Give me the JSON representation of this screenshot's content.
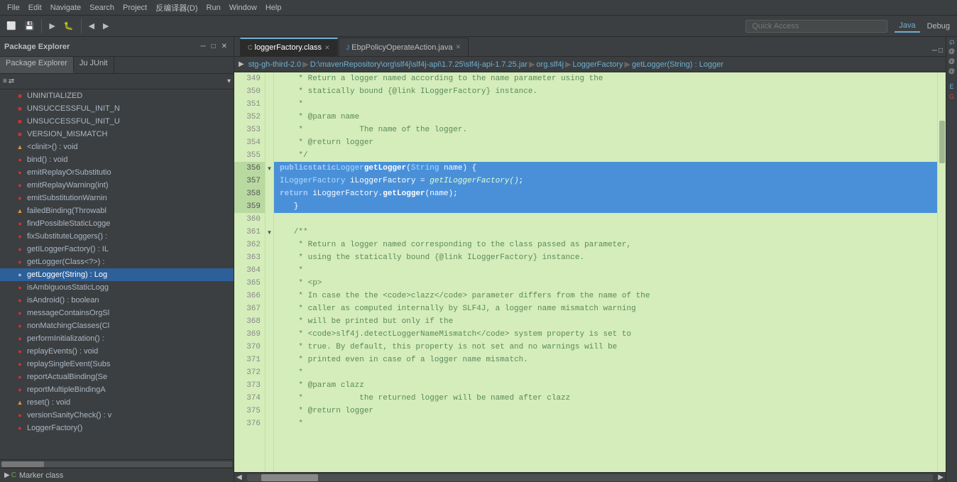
{
  "menubar": {
    "items": [
      "File",
      "Edit",
      "Navigate",
      "Search",
      "Project",
      "反编译器(D)",
      "Run",
      "Window",
      "Help"
    ]
  },
  "toolbar": {
    "quick_access_placeholder": "Quick Access",
    "right_buttons": [
      "Java",
      "Debug"
    ]
  },
  "left_panel": {
    "title": "Package Explorer",
    "tabs": [
      {
        "label": "Package Explorer",
        "active": true
      },
      {
        "label": "Ju JUnit",
        "active": false
      }
    ],
    "tree_items": [
      {
        "label": "UNINITIALIZED",
        "type": "field",
        "indent": 4
      },
      {
        "label": "UNSUCCESSFUL_INIT_N",
        "type": "field",
        "indent": 4
      },
      {
        "label": "UNSUCCESSFUL_INIT_U",
        "type": "field",
        "indent": 4
      },
      {
        "label": "VERSION_MISMATCH",
        "type": "field",
        "indent": 4
      },
      {
        "label": "<clinit>() : void",
        "type": "method-warn",
        "indent": 4
      },
      {
        "label": "bind() : void",
        "type": "method-green",
        "indent": 4
      },
      {
        "label": "emitReplayOrSubstitutio",
        "type": "method-green",
        "indent": 4
      },
      {
        "label": "emitReplayWarning(int)",
        "type": "method-green",
        "indent": 4
      },
      {
        "label": "emitSubstitutionWarnin",
        "type": "method-green",
        "indent": 4
      },
      {
        "label": "failedBinding(Throwabl",
        "type": "method-warn",
        "indent": 4
      },
      {
        "label": "findPossibleStaticLogge",
        "type": "method-green",
        "indent": 4
      },
      {
        "label": "fixSubstituteLoggers() :",
        "type": "method-green",
        "indent": 4
      },
      {
        "label": "getILoggerFactory() : IL",
        "type": "method-green",
        "indent": 4
      },
      {
        "label": "getLogger(Class<?>) :",
        "type": "method-green",
        "indent": 4
      },
      {
        "label": "getLogger(String) : Log",
        "type": "method-green",
        "indent": 4,
        "selected": true
      },
      {
        "label": "isAmbiguousStaticLogg",
        "type": "method-green",
        "indent": 4
      },
      {
        "label": "isAndroid() : boolean",
        "type": "method-green",
        "indent": 4
      },
      {
        "label": "messageContainsOrgSl",
        "type": "method-green",
        "indent": 4
      },
      {
        "label": "nonMatchingClasses(Cl",
        "type": "method-green",
        "indent": 4
      },
      {
        "label": "performInitialization() :",
        "type": "method-green",
        "indent": 4
      },
      {
        "label": "replayEvents() : void",
        "type": "method-green",
        "indent": 4
      },
      {
        "label": "replaySingleEvent(Subs",
        "type": "method-green",
        "indent": 4
      },
      {
        "label": "reportActualBinding(Se",
        "type": "method-green",
        "indent": 4
      },
      {
        "label": "reportMultipleBindingA",
        "type": "method-green",
        "indent": 4
      },
      {
        "label": "reset() : void",
        "type": "method-warn",
        "indent": 4
      },
      {
        "label": "versionSanityCheck() : v",
        "type": "method-green",
        "indent": 4
      },
      {
        "label": "LoggerFactory()",
        "type": "method-green",
        "indent": 4
      }
    ],
    "bottom_item": "Marker class"
  },
  "editor": {
    "tabs": [
      {
        "label": "loggerFactory.class",
        "active": true
      },
      {
        "label": "EbpPolicyOperateAction.java",
        "active": false
      }
    ],
    "breadcrumb": [
      "stg-gh-third-2.0",
      "D:\\mavenRepository\\org\\slf4j\\slf4j-api\\1.7.25\\slf4j-api-1.7.25.jar",
      "org.slf4j",
      "LoggerFactory",
      "getLogger(String) : Logger"
    ],
    "lines": [
      {
        "num": 349,
        "highlight": false,
        "text": "    * Return a logger named according to the name parameter using the"
      },
      {
        "num": 350,
        "highlight": false,
        "text": "    * statically bound {@link ILoggerFactory} instance."
      },
      {
        "num": 351,
        "highlight": false,
        "text": "    *"
      },
      {
        "num": 352,
        "highlight": false,
        "text": "    * @param name"
      },
      {
        "num": 353,
        "highlight": false,
        "text": "    *            The name of the logger."
      },
      {
        "num": 354,
        "highlight": false,
        "text": "    * @return logger"
      },
      {
        "num": 355,
        "highlight": false,
        "text": "    */"
      },
      {
        "num": 356,
        "highlight": true,
        "text": "   public static Logger getLogger(String name) {"
      },
      {
        "num": 357,
        "highlight": true,
        "text": "        ILoggerFactory iLoggerFactory = getILoggerFactory();"
      },
      {
        "num": 358,
        "highlight": true,
        "text": "        return iLoggerFactory.getLogger(name);"
      },
      {
        "num": 359,
        "highlight": true,
        "text": "   }"
      },
      {
        "num": 360,
        "highlight": false,
        "text": ""
      },
      {
        "num": 361,
        "highlight": false,
        "text": "   /**"
      },
      {
        "num": 362,
        "highlight": false,
        "text": "    * Return a logger named corresponding to the class passed as parameter,"
      },
      {
        "num": 363,
        "highlight": false,
        "text": "    * using the statically bound {@link ILoggerFactory} instance."
      },
      {
        "num": 364,
        "highlight": false,
        "text": "    *"
      },
      {
        "num": 365,
        "highlight": false,
        "text": "    * <p>"
      },
      {
        "num": 366,
        "highlight": false,
        "text": "    * In case the the <code>clazz</code> parameter differs from the name of the"
      },
      {
        "num": 367,
        "highlight": false,
        "text": "    * caller as computed internally by SLF4J, a logger name mismatch warning"
      },
      {
        "num": 368,
        "highlight": false,
        "text": "    * will be printed but only if the"
      },
      {
        "num": 369,
        "highlight": false,
        "text": "    * <code>slf4j.detectLoggerNameMismatch</code> system property is set to"
      },
      {
        "num": 370,
        "highlight": false,
        "text": "    * true. By default, this property is not set and no warnings will be"
      },
      {
        "num": 371,
        "highlight": false,
        "text": "    * printed even in case of a logger name mismatch."
      },
      {
        "num": 372,
        "highlight": false,
        "text": "    *"
      },
      {
        "num": 373,
        "highlight": false,
        "text": "    * @param clazz"
      },
      {
        "num": 374,
        "highlight": false,
        "text": "    *            the returned logger will be named after clazz"
      },
      {
        "num": 375,
        "highlight": false,
        "text": "    * @return logger"
      },
      {
        "num": 376,
        "highlight": false,
        "text": "    *"
      }
    ]
  }
}
